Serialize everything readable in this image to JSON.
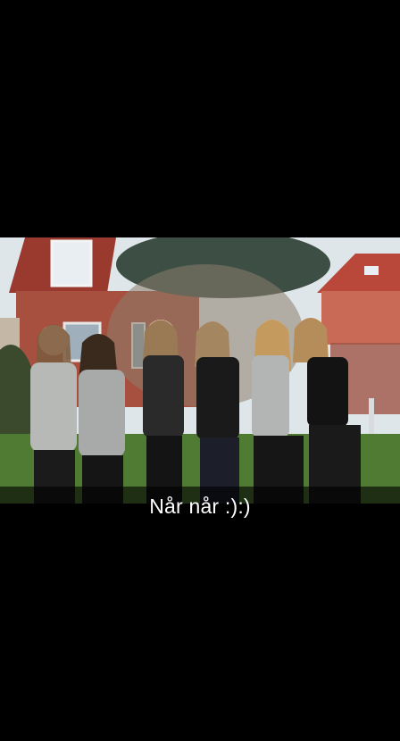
{
  "snap": {
    "caption": "Når når :):)"
  },
  "colors": {
    "background": "#000000",
    "caption_bar": "#000000",
    "caption_text": "#ffffff"
  },
  "photo": {
    "icon": "photo-content"
  }
}
